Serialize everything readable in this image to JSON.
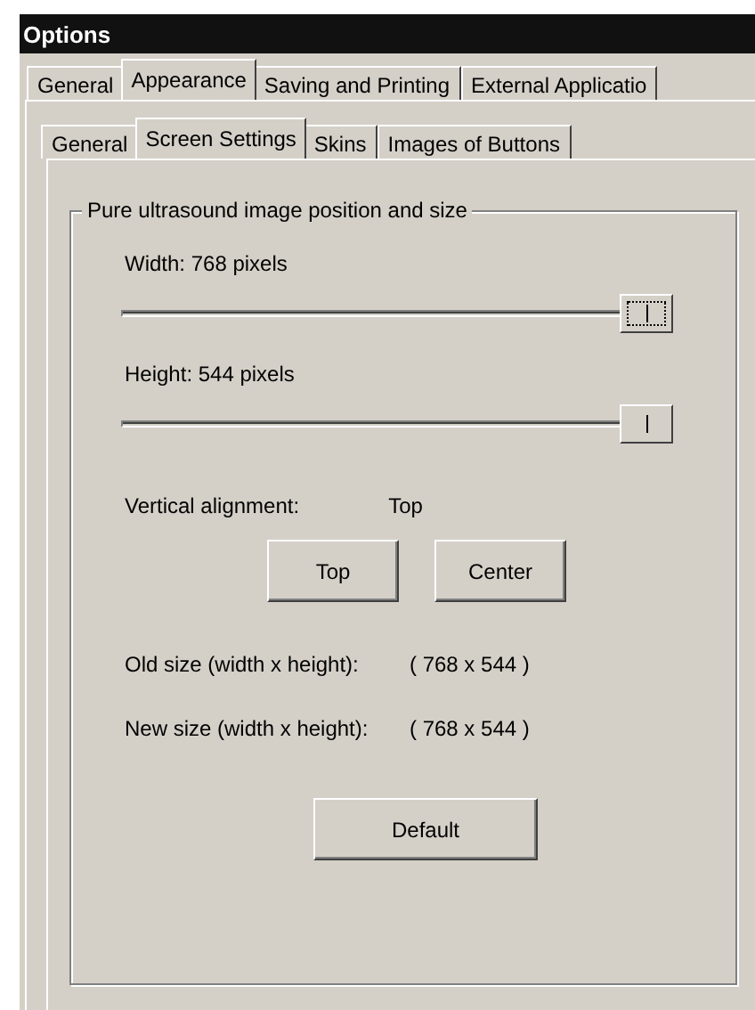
{
  "window": {
    "title": "Options"
  },
  "tabs": [
    {
      "label": "General",
      "selected": false
    },
    {
      "label": "Appearance",
      "selected": true
    },
    {
      "label": "Saving and Printing",
      "selected": false
    },
    {
      "label": "External Applicatio",
      "selected": false
    }
  ],
  "subtabs": [
    {
      "label": "General",
      "selected": false
    },
    {
      "label": "Screen Settings",
      "selected": true
    },
    {
      "label": "Skins",
      "selected": false
    },
    {
      "label": "Images of Buttons",
      "selected": false
    }
  ],
  "group": {
    "title": "Pure ultrasound image position and size",
    "sliders": [
      {
        "label": "Width:  768 pixels",
        "level": 1,
        "focused": true
      },
      {
        "label": "Height:  544 pixels",
        "level": 1,
        "focused": false
      }
    ],
    "alignment": {
      "label": "Vertical alignment:",
      "value": "Top"
    },
    "alignment_buttons": [
      "Top",
      "Center"
    ],
    "sizes": [
      {
        "label": "Old size (width x height):",
        "value": "( 768 x 544 )"
      },
      {
        "label": "New size (width x height):",
        "value": "( 768 x 544 )"
      }
    ],
    "default_button": "Default"
  }
}
